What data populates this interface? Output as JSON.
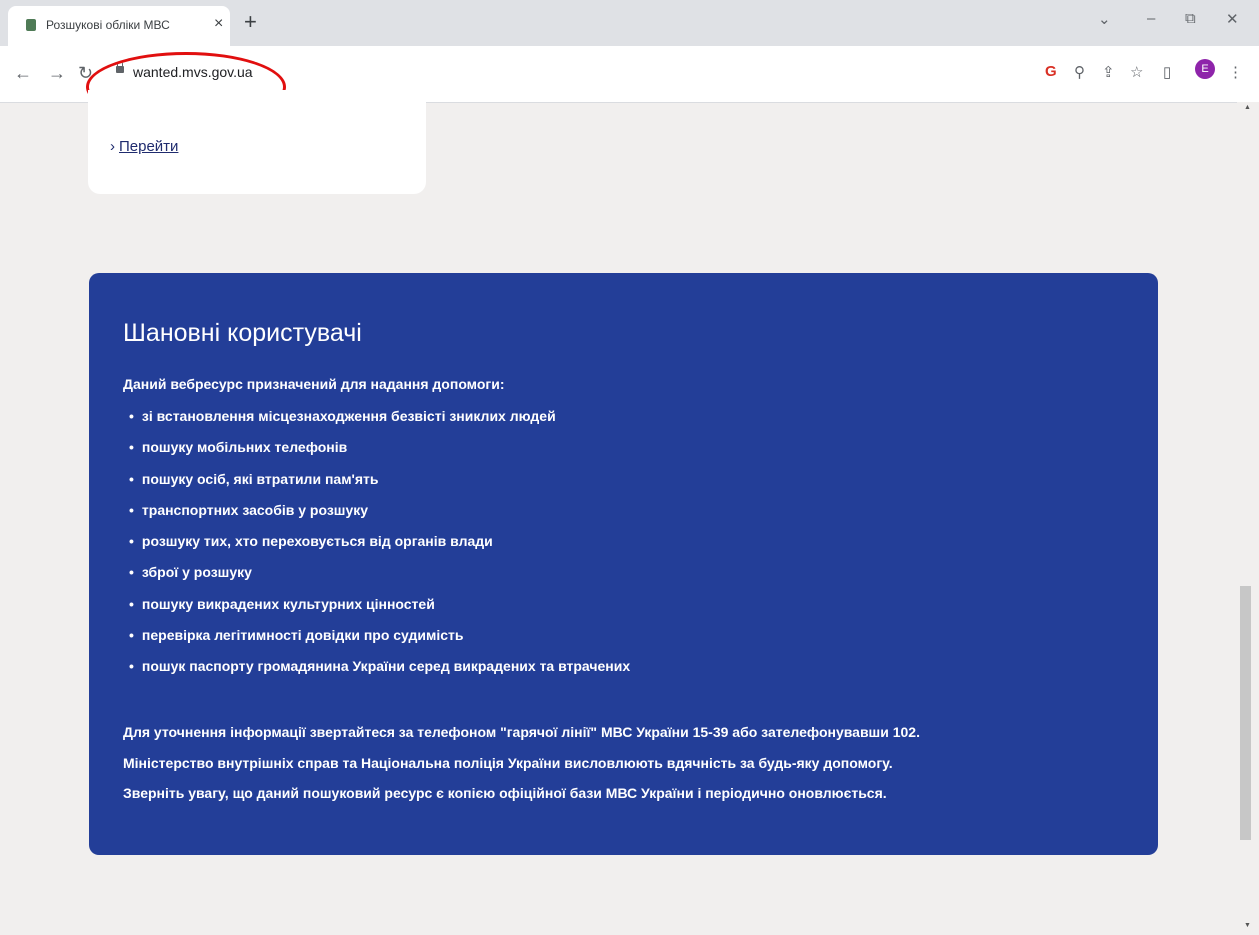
{
  "browser": {
    "tab_title": "Розшукові обліки МВС",
    "tab_close": "×",
    "new_tab": "+",
    "url": "wanted.mvs.gov.ua",
    "window_controls": {
      "dropdown": "⌄",
      "minimize": "–",
      "restore": "⧉",
      "close": "✕"
    },
    "nav": {
      "back": "←",
      "forward": "→",
      "reload": "↻"
    },
    "extensions": [
      "G",
      "⚲",
      "⇪",
      "☆",
      "▯"
    ],
    "profile_initial": "E",
    "menu": "⋮",
    "colors": {
      "profile": "#8e24aa",
      "annotation": "#e10f0f"
    }
  },
  "card": {
    "link_chevron": "›",
    "link_text": "Перейти"
  },
  "notice": {
    "title": "Шановні користувачі",
    "intro": "Даний вебресурс призначений для надання допомоги:",
    "items": [
      "зі встановлення місцезнаходження безвісті зниклих людей",
      "пошуку мобільних телефонів",
      "пошуку осіб, які втратили пам'ять",
      "транспортних засобів у розшуку",
      "розшуку тих, хто переховується від органів влади",
      "зброї у розшуку",
      "пошуку викрадених культурних цінностей",
      "перевірка легітимності довідки про судимість",
      "пошук паспорту громадянина України серед викрадених та втрачених"
    ],
    "footer": [
      "Для уточнення інформації звертайтеся за телефоном \"гарячої лінії\" МВС України 15-39 або зателефонувавши 102.",
      "Міністерство внутрішніх справ та Національна поліція України висловлюють вдячність за будь-яку допомогу.",
      "Зверніть увагу, що даний пошуковий ресурс є копією офіційної бази МВС України і періодично оновлюється."
    ],
    "colors": {
      "panel_background": "#233e98",
      "text": "#ffffff"
    }
  },
  "scroll": {
    "up": "▲",
    "down": "▼",
    "position_fraction": 0.62
  }
}
